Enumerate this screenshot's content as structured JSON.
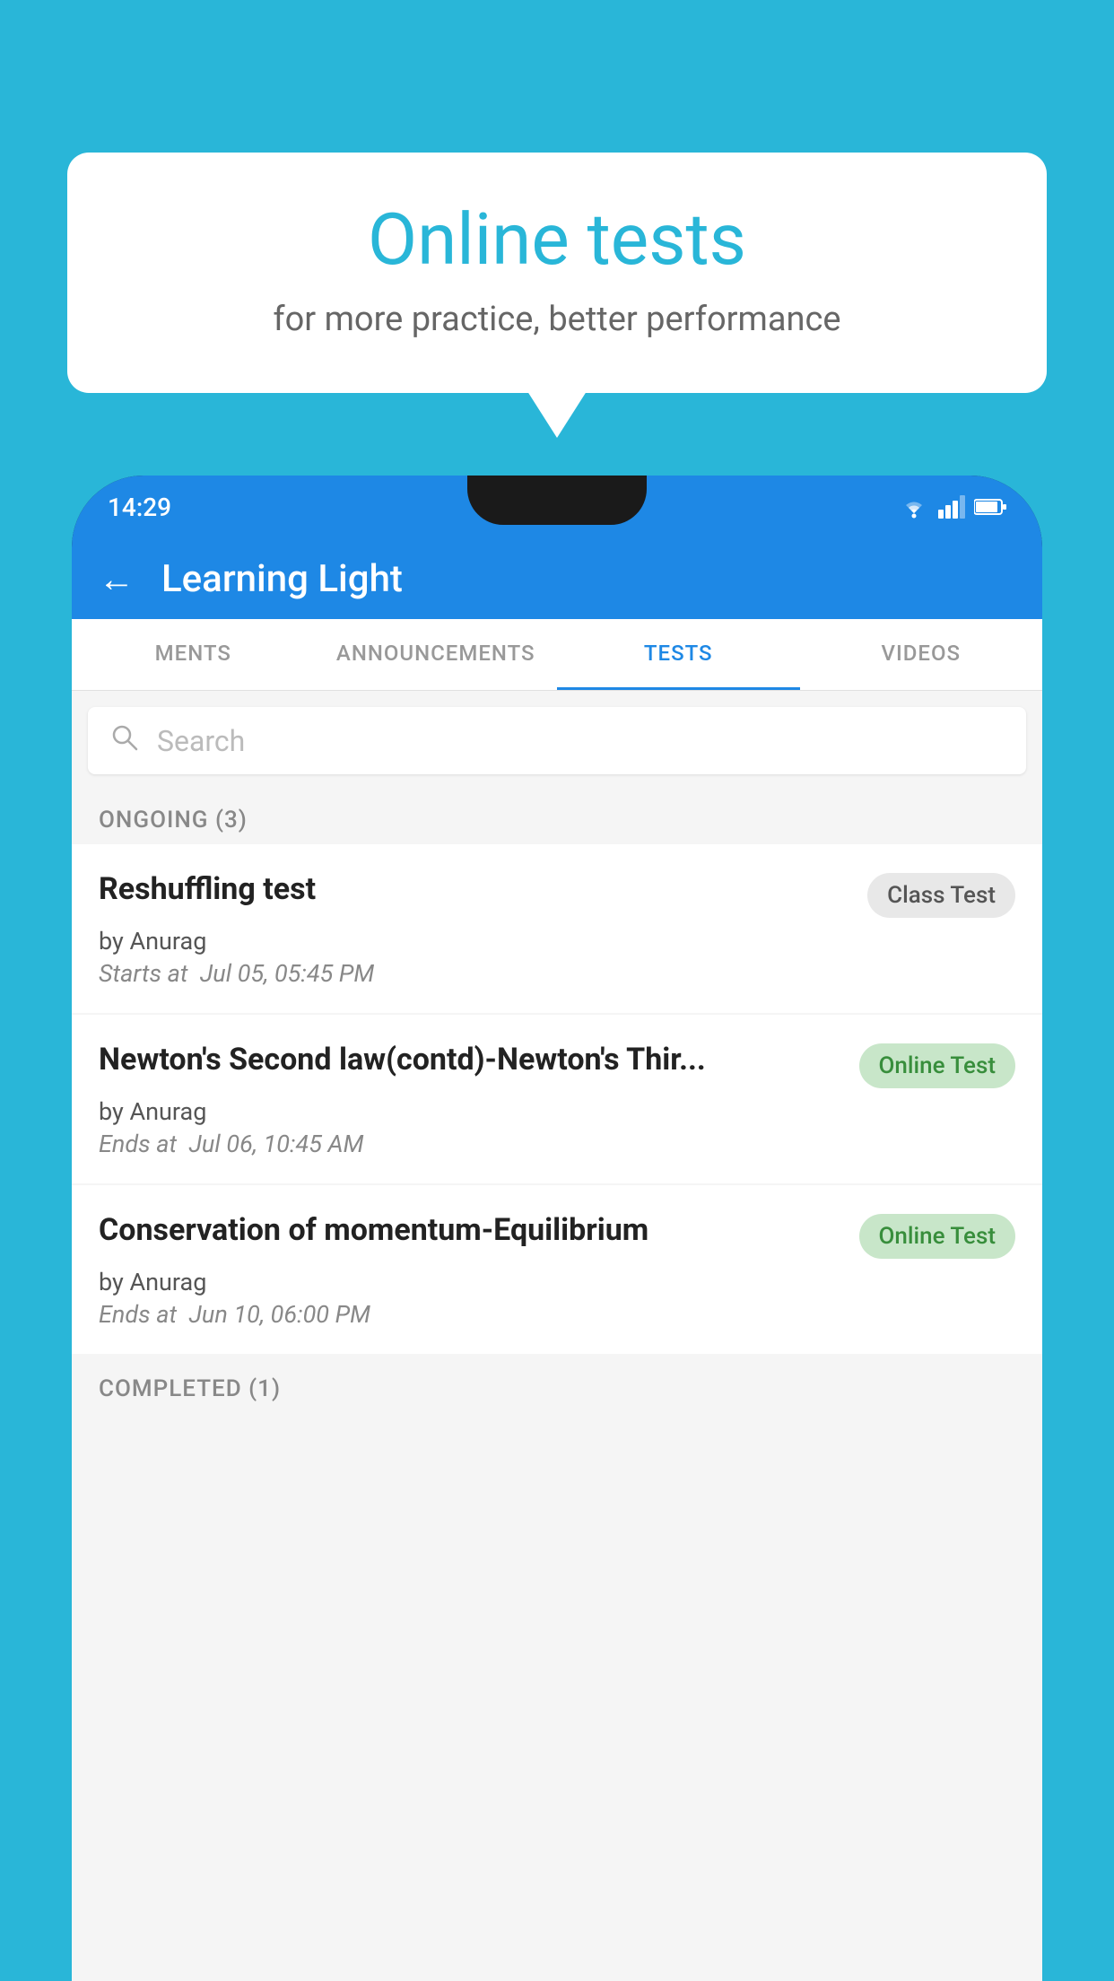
{
  "background_color": "#29B6D8",
  "bubble": {
    "title": "Online tests",
    "subtitle": "for more practice, better performance"
  },
  "status_bar": {
    "time": "14:29"
  },
  "app_header": {
    "title": "Learning Light",
    "back_label": "←"
  },
  "tabs": [
    {
      "label": "MENTS",
      "active": false
    },
    {
      "label": "ANNOUNCEMENTS",
      "active": false
    },
    {
      "label": "TESTS",
      "active": true
    },
    {
      "label": "VIDEOS",
      "active": false
    }
  ],
  "search": {
    "placeholder": "Search"
  },
  "ongoing_section": {
    "label": "ONGOING (3)"
  },
  "test_items": [
    {
      "name": "Reshuffling test",
      "badge": "Class Test",
      "badge_type": "class",
      "by": "by Anurag",
      "time_label": "Starts at",
      "time_value": "Jul 05, 05:45 PM"
    },
    {
      "name": "Newton's Second law(contd)-Newton's Thir...",
      "badge": "Online Test",
      "badge_type": "online",
      "by": "by Anurag",
      "time_label": "Ends at",
      "time_value": "Jul 06, 10:45 AM"
    },
    {
      "name": "Conservation of momentum-Equilibrium",
      "badge": "Online Test",
      "badge_type": "online",
      "by": "by Anurag",
      "time_label": "Ends at",
      "time_value": "Jun 10, 06:00 PM"
    }
  ],
  "completed_section": {
    "label": "COMPLETED (1)"
  }
}
